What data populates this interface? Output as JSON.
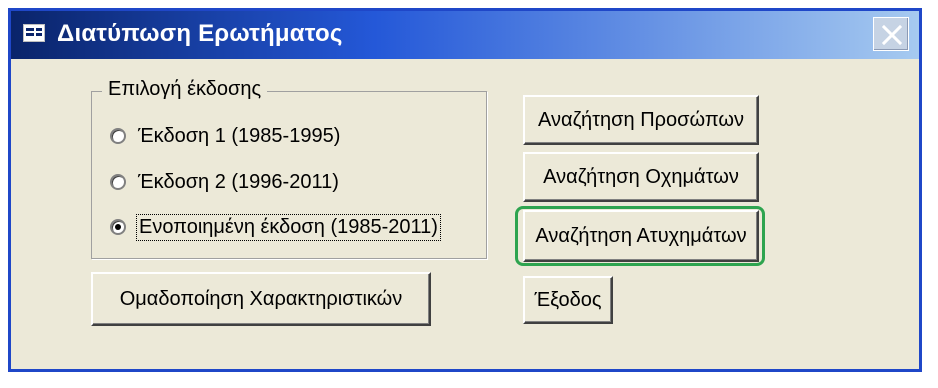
{
  "window": {
    "title": "Διατύπωση Ερωτήματος",
    "title_icon": "form-icon",
    "close_icon": "close-icon"
  },
  "version_group": {
    "legend": "Επιλογή έκδοσης",
    "options": [
      {
        "label": "Έκδοση 1 (1985-1995)",
        "checked": false
      },
      {
        "label": "Έκδοση 2 (1996-2011)",
        "checked": false
      },
      {
        "label": "Ενοποιημένη έκδοση (1985-2011)",
        "checked": true
      }
    ]
  },
  "buttons": {
    "group_features": "Ομαδοποίηση Χαρακτηριστικών",
    "search_persons": "Αναζήτηση Προσώπων",
    "search_vehicles": "Αναζήτηση Οχημάτων",
    "search_accidents": "Αναζήτηση Ατυχημάτων",
    "exit": "Έξοδος"
  },
  "colors": {
    "titlebar_start": "#0a246a",
    "titlebar_end": "#a6caf0",
    "dialog_bg": "#ece9d8",
    "highlight": "#2ea44f"
  }
}
